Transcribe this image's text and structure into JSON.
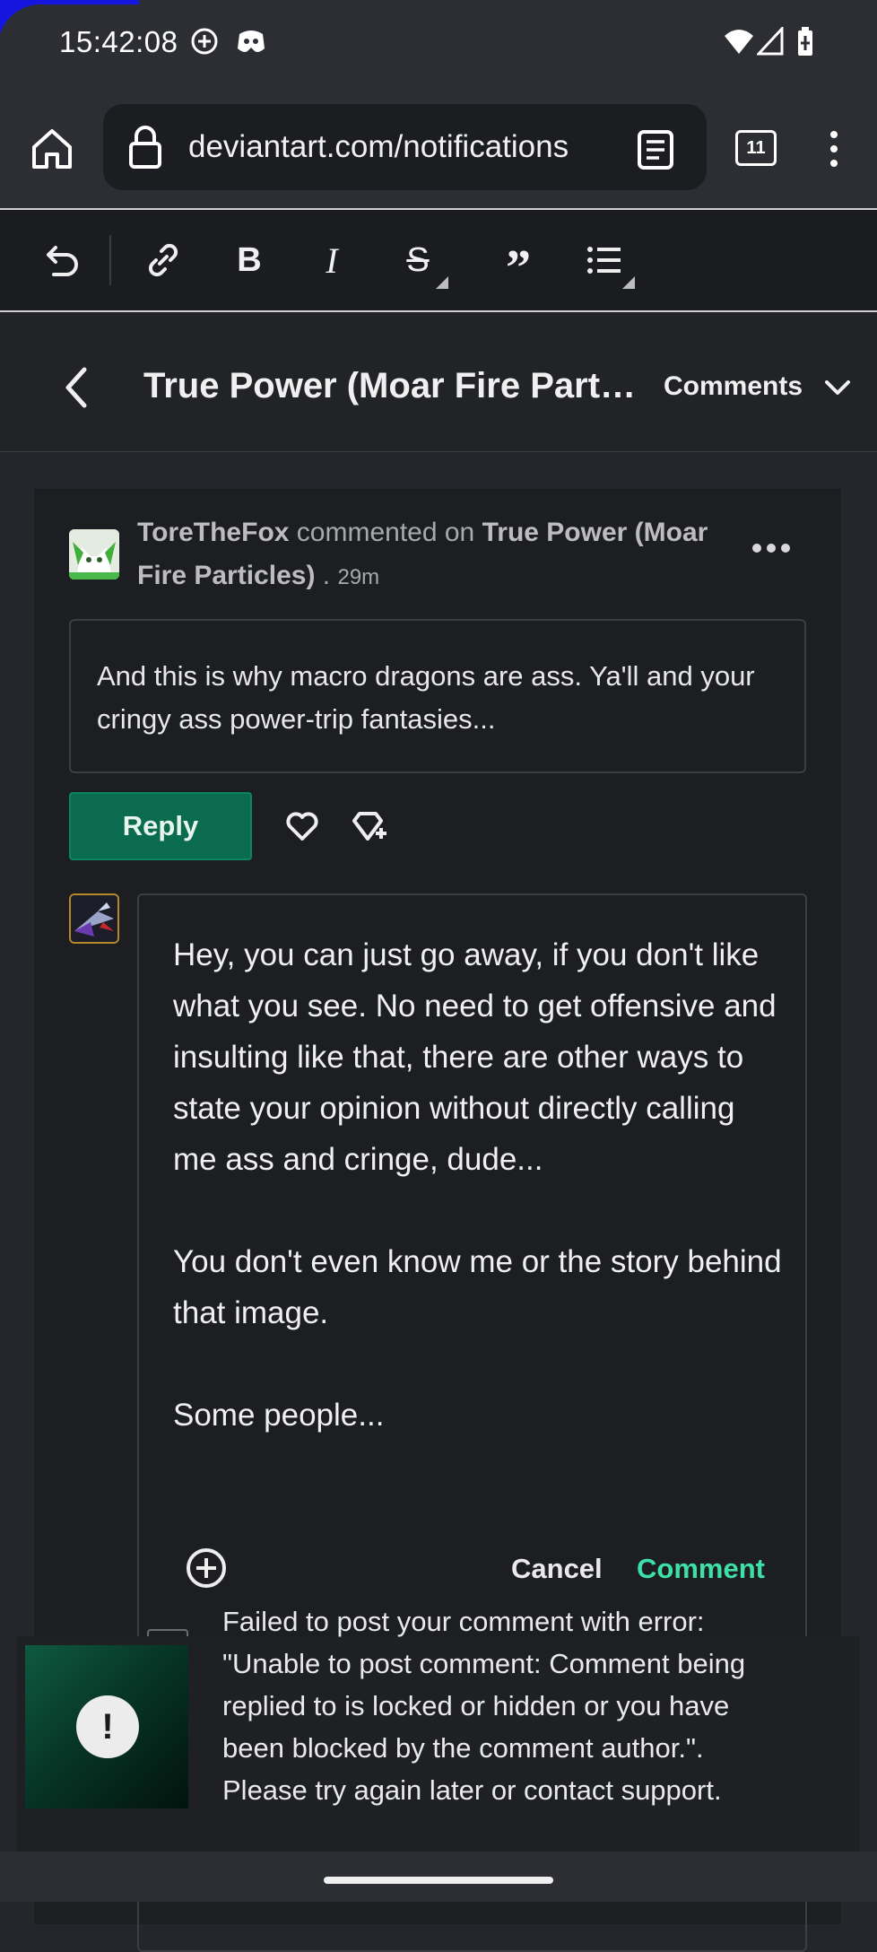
{
  "status_bar": {
    "time": "15:42:08"
  },
  "browser": {
    "url": "deviantart.com/notifications",
    "tab_count": "11"
  },
  "header": {
    "title": "True Power (Moar Fire Part…",
    "comments_label": "Comments"
  },
  "notification": {
    "user": "ToreTheFox",
    "action": "commented on",
    "target": "True Power (Moar Fire Particles)",
    "separator": ".",
    "time_ago": "29m"
  },
  "comment": {
    "text": "And this is why macro dragons are ass. Ya'll and your cringy ass power-trip fantasies..."
  },
  "actions": {
    "reply_label": "Reply"
  },
  "reply_editor": {
    "text": "Hey, you can just go away, if you don't like what you see. No need to get offensive and insulting like that, there are other ways to state your opinion without directly calling me ass and cringe, dude...\n\nYou don't even know me or the story behind that image.\n\nSome people...",
    "cancel_label": "Cancel",
    "comment_label": "Comment"
  },
  "toast": {
    "message": "Failed to post your comment with error: \"Unable to post comment: Comment being replied to is locked or hidden or you have been blocked by the comment author.\". Please try again later or contact support.",
    "icon": "!"
  },
  "colors": {
    "accent": "#3de0a6",
    "reply_button": "#0a6b4f",
    "background": "#24262b"
  }
}
